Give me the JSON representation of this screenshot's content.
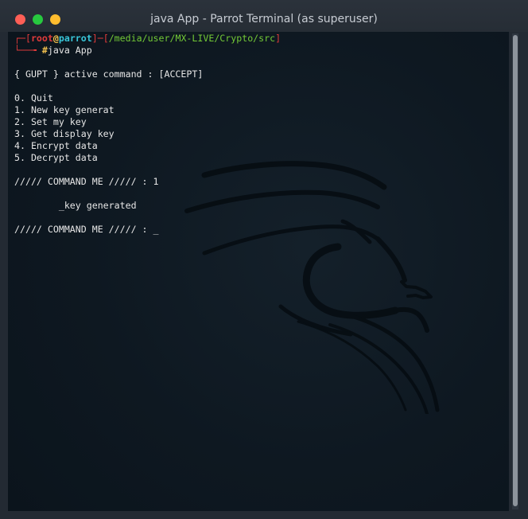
{
  "window": {
    "title": "java App - Parrot Terminal (as superuser)"
  },
  "terminal": {
    "prompt": {
      "open_bracket": "┌─[",
      "user": "root",
      "at": "@",
      "host": "parrot",
      "separator": "]─[",
      "path": "/media/user/MX-LIVE/Crypto/src",
      "close_bracket": "]",
      "second_line_prefix": "└──╼ ",
      "hash": "#",
      "command": "java App"
    },
    "lines": [
      "{ GUPT } active command : [ACCEPT]",
      "0. Quit",
      "1. New key generat",
      "2. Set my key",
      "3. Get display key",
      "4. Encrypt data",
      "5. Decrypt data",
      "///// COMMAND ME ///// : 1",
      "        _key generated",
      "///// COMMAND ME ///// : _"
    ]
  },
  "colors": {
    "prompt_red": "#e13b3b",
    "prompt_green": "#73c936",
    "prompt_cyan": "#38c6d9",
    "text": "#e6e6e6"
  }
}
